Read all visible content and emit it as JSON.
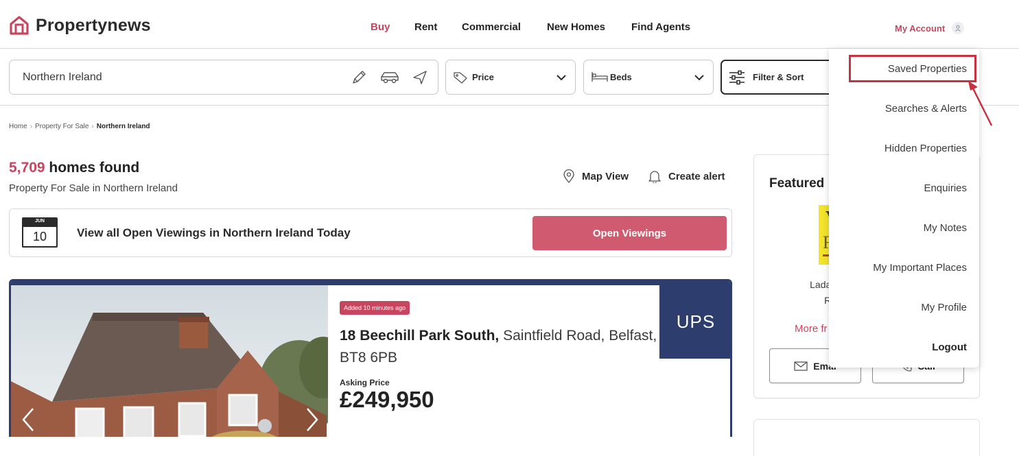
{
  "brand": {
    "name": "Propertynews",
    "accent": "#c7455e",
    "agent_navy": "#2c3d6e"
  },
  "nav": [
    {
      "label": "Buy",
      "active": true
    },
    {
      "label": "Rent",
      "active": false
    },
    {
      "label": "Commercial",
      "active": false
    },
    {
      "label": "New Homes",
      "active": false
    },
    {
      "label": "Find Agents",
      "active": false
    }
  ],
  "account": {
    "label": "My Account",
    "icon": "user-icon"
  },
  "search": {
    "location_value": "Northern Ireland",
    "price_label": "Price",
    "beds_label": "Beds",
    "filter_label": "Filter & Sort"
  },
  "breadcrumb": [
    "Home",
    "Property For Sale",
    "Northern Ireland"
  ],
  "results": {
    "count": "5,709",
    "count_suffix": " homes found",
    "subtitle": "Property For Sale in Northern Ireland",
    "map_view": "Map View",
    "create_alert": "Create alert"
  },
  "open_viewings": {
    "calendar_month": "JUN",
    "calendar_day": "10",
    "text": "View all Open Viewings in Northern Ireland Today",
    "button": "Open Viewings"
  },
  "listing": {
    "badge": "Added 10 minutes ago",
    "address_bold": "18 Beechill Park South,",
    "address_rest": " Saintfield Road, Belfast, BT8 6PB",
    "asking_label": "Asking Price",
    "price": "£249,950",
    "agent_logo": "UPS"
  },
  "featured": {
    "title": "Featured",
    "logo_letters": [
      "V",
      "F"
    ],
    "address_line1": "Ladas Hou",
    "address_line2": "Roa",
    "more_link": "More fr",
    "email_label": "Emai",
    "call_label": "Call"
  },
  "account_menu": {
    "items": [
      "Saved Properties",
      "Searches & Alerts",
      "Hidden Properties",
      "Enquiries",
      "My Notes",
      "My Important Places",
      "My Profile",
      "Logout"
    ],
    "highlighted": "Saved Properties",
    "highlight_color": "#c8313f"
  }
}
